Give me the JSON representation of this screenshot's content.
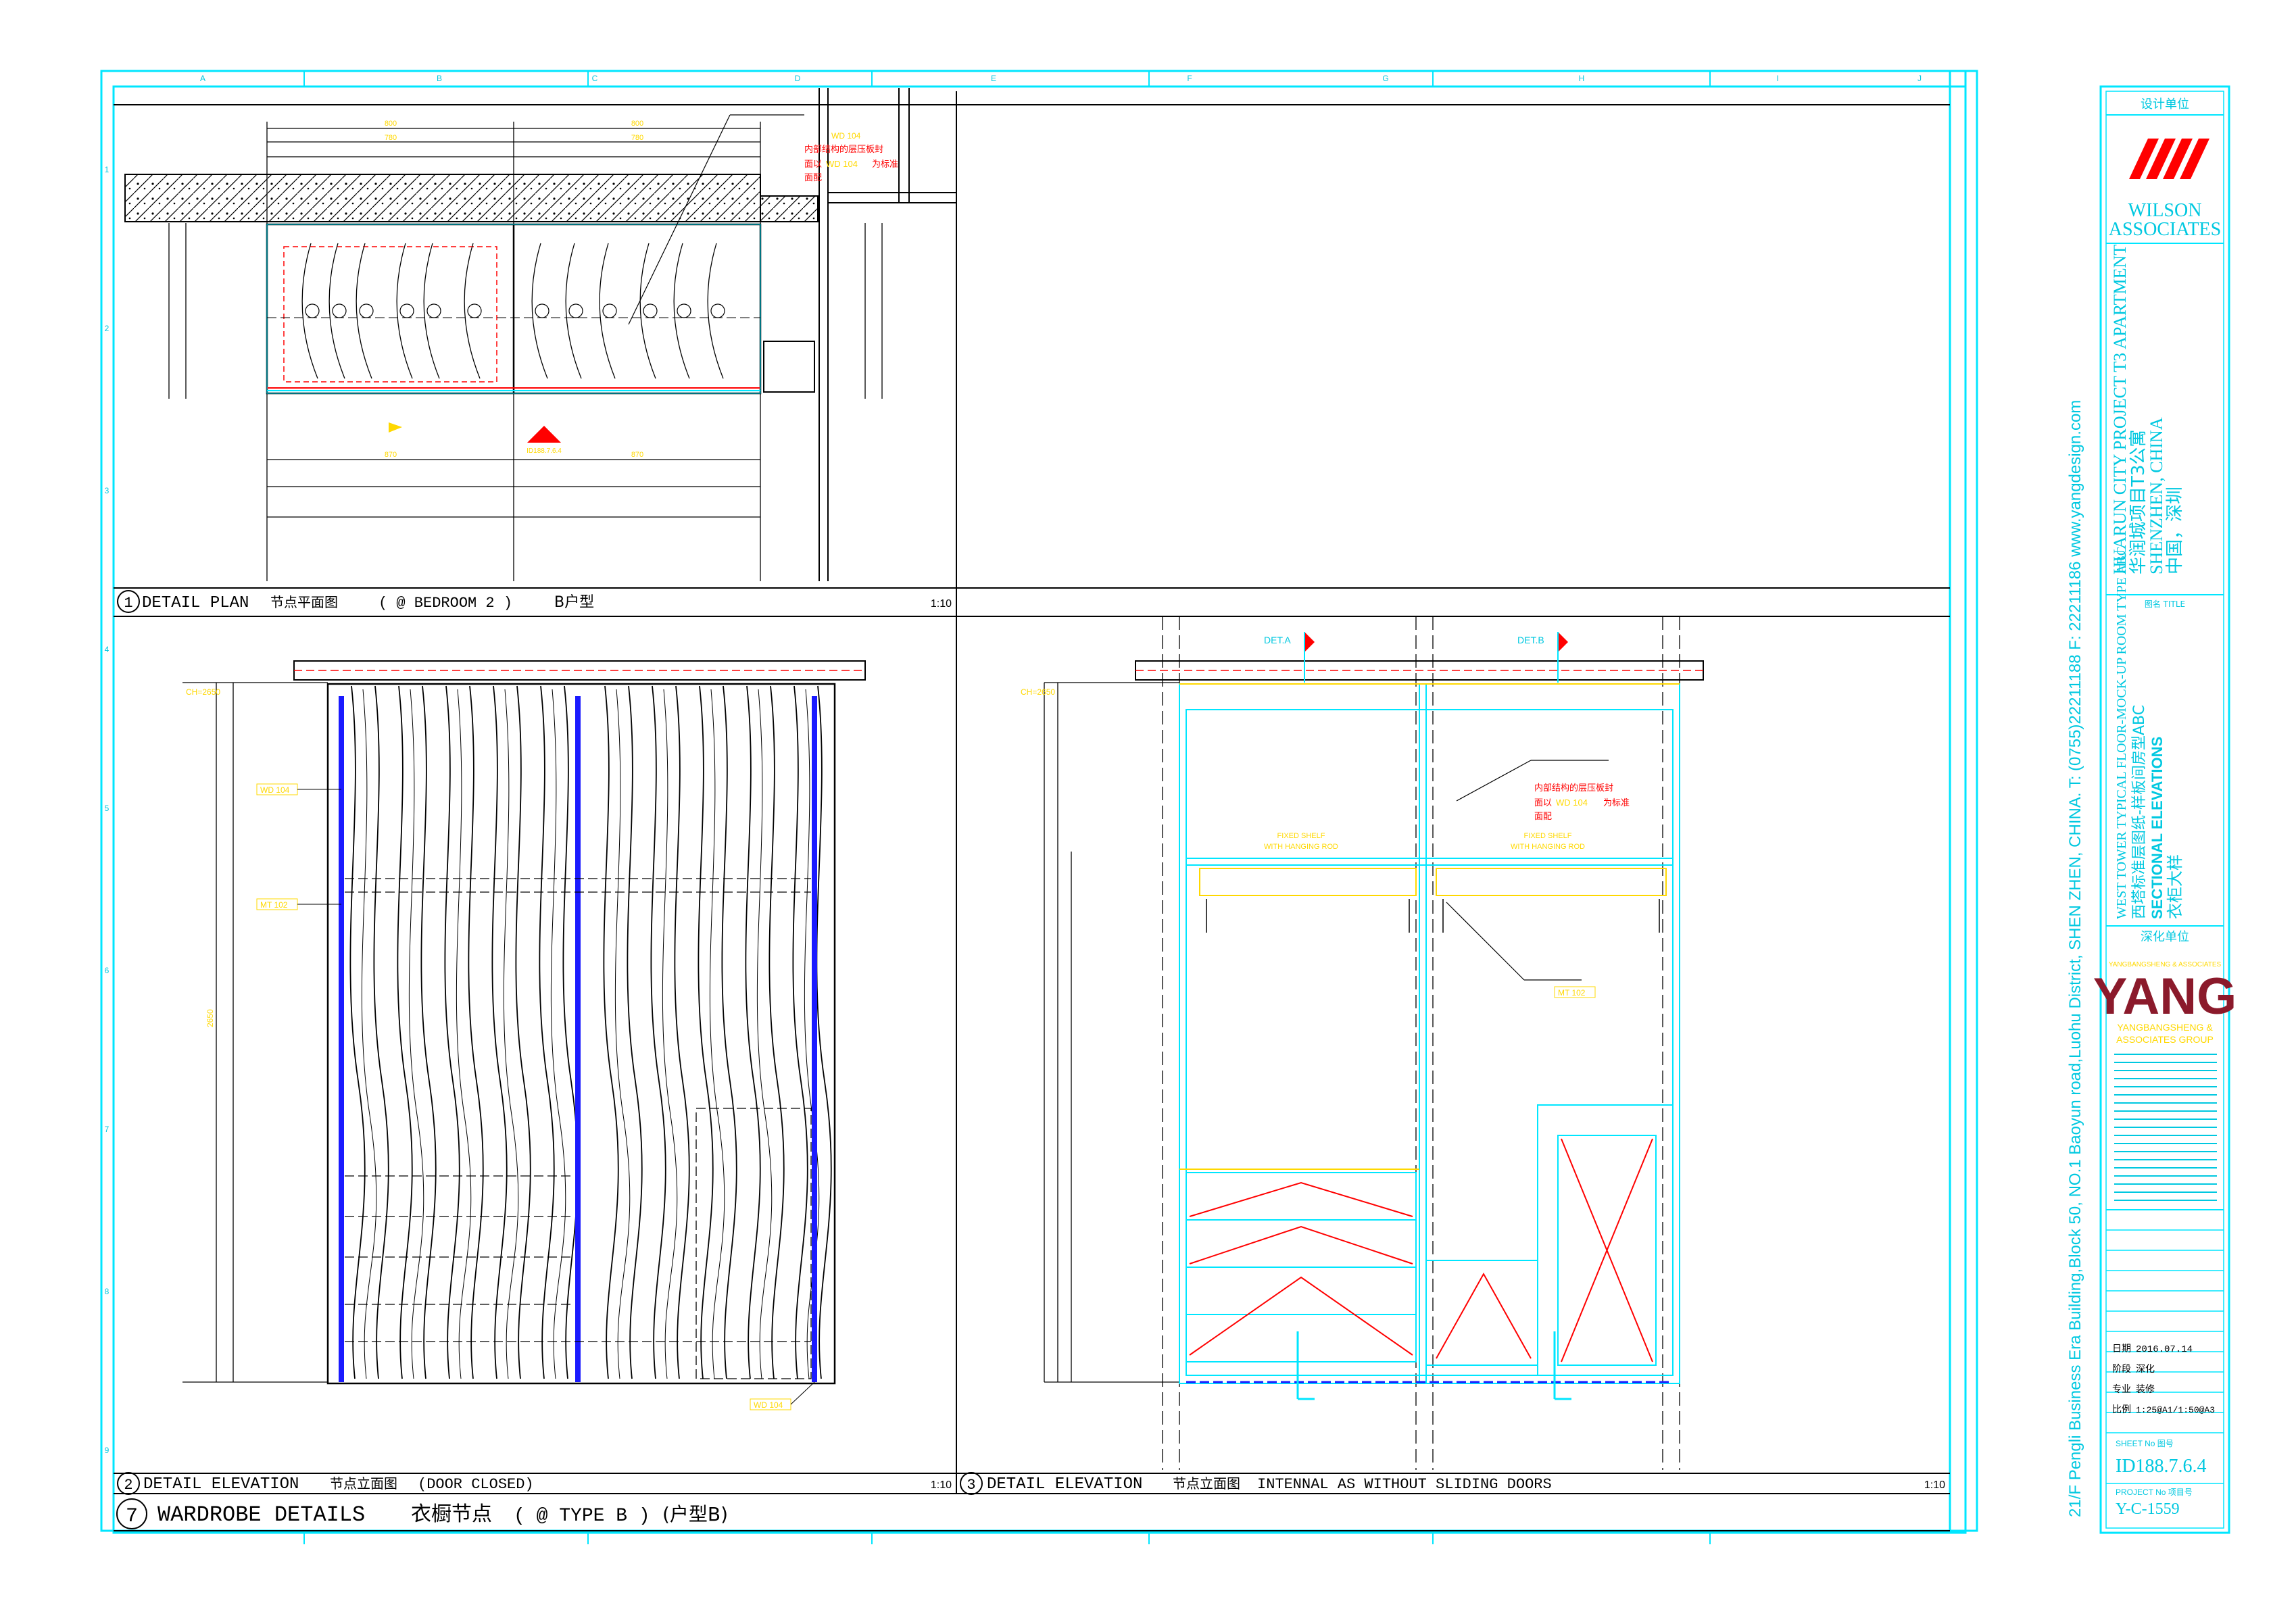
{
  "grid": {
    "columns": [
      "A",
      "B",
      "C",
      "D",
      "E",
      "F",
      "G",
      "H",
      "I",
      "J"
    ],
    "rows": [
      "1",
      "2",
      "3",
      "4",
      "5",
      "6",
      "7",
      "8",
      "9"
    ]
  },
  "panel1": {
    "number": "1",
    "title": "DETAIL PLAN",
    "title_cn": "节点平面图",
    "location": "( @ BEDROOM 2 )",
    "type": "B户型",
    "scale": "1:10",
    "callout_text_line1": "内部结构的层压板封",
    "callout_text_line2": "面以",
    "callout_code": "WD 104",
    "callout_text_line3": "为标准",
    "callout_text_line4": "面配",
    "material_tag": "WD 104"
  },
  "panel2": {
    "number": "2",
    "title": "DETAIL ELEVATION",
    "title_cn": "节点立面图",
    "subtitle": "(DOOR CLOSED)",
    "scale": "1:10",
    "tags": [
      "WD 104",
      "MT 102",
      "WD 104"
    ],
    "ch_label": "CH=2650"
  },
  "panel3": {
    "number": "3",
    "title": "DETAIL ELEVATION",
    "title_cn": "节点立面图",
    "subtitle": "INTENNAL AS WITHOUT SLIDING DOORS",
    "scale": "1:10",
    "det_a": "DET.A",
    "det_b": "DET.B",
    "ch_label": "CH=2650",
    "callout_text_line1": "内部结构的层压板封",
    "callout_text_line2": "面以",
    "callout_code": "WD 104",
    "callout_text_line3": "为标准",
    "callout_text_line4": "面配",
    "tag": "MT 102"
  },
  "footer": {
    "number": "7",
    "title": "WARDROBE DETAILS",
    "title_cn": "衣橱节点",
    "type": "( @ TYPE B )",
    "type_cn": "(户型B)"
  },
  "titleblock": {
    "design_unit_label": "设计单位",
    "firm_line1": "WILSON",
    "firm_line2": "ASSOCIATES",
    "project_en": "HUARUN CITY PROJECT T3 APARTMENT",
    "project_cn": "华润城项目T3公寓",
    "location_en": "SHENZHEN, CHINA",
    "location_cn": "中国，深圳",
    "title_label": "图名 TITLE",
    "title_en1": "WEST TOWER TYPICAL FLOOR-MOCK-UP ROOM TYPE ABC",
    "title_cn1": "西塔标准层图纸-样板间房型ABC",
    "title_en2": "SECTIONAL ELEVATIONS",
    "title_cn2": "衣柜大样",
    "deep_design_label": "深化单位",
    "yang_logo": "YANG",
    "yang_line1": "YANGBANGSHENG &",
    "yang_line2": "ASSOCIATES GROUP",
    "date_label": "日期",
    "date": "2016.07.14",
    "stage_label": "阶段",
    "stage": "深化",
    "drawer_label": "专业",
    "drawer": "装修",
    "scale_label": "比例",
    "scale": "1:25@A1/1:50@A3",
    "sheet_no_label": "SHEET No 图号",
    "sheet_no": "ID188.7.6.4",
    "project_no_label": "PROJECT No 项目号",
    "project_no": "Y-C-1559",
    "side_text": "21/F Pengli Business Era Building,Block 50, NO.1 Baoyun road,Luohu District, SHEN ZHEN, CHINA. T: (0755)22211188  F: 22211186  www.yangdesign.com"
  },
  "colors": {
    "frame": "#00e6ff",
    "ink": "#000000",
    "red": "#ff0000",
    "yellow": "#ffd800",
    "blue": "#1a1aff",
    "maroon": "#8b1a2b",
    "cyan_dark": "#00c8e0"
  }
}
